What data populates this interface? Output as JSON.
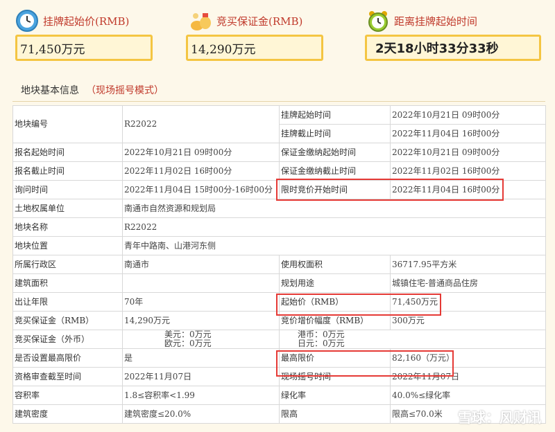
{
  "summary": {
    "start_price_label": "挂牌起始价(RMB)",
    "start_price_value": "71,450万元",
    "deposit_label": "竞买保证金(RMB)",
    "deposit_value": "14,290万元",
    "countdown_label": "距离挂牌起始时间",
    "countdown_value": "2天18小时33分33秒",
    "icons": [
      "clock-icon",
      "money-bag-icon",
      "alarm-clock-icon"
    ]
  },
  "section": {
    "title": "地块基本信息",
    "mode": "（现场摇号模式）"
  },
  "table": {
    "rows": [
      {
        "k1": "地块编号",
        "v1": "R22022",
        "k2a": "挂牌起始时间",
        "v2a": "2022年10月21日 09时00分",
        "k2b": "挂牌截止时间",
        "v2b": "2022年11月04日 16时00分"
      },
      {
        "k1": "报名起始时间",
        "v1": "2022年10月21日 09时00分",
        "k2": "保证金缴纳起始时间",
        "v2": "2022年10月21日 09时00分"
      },
      {
        "k1": "报名截止时间",
        "v1": "2022年11月02日 16时00分",
        "k2": "保证金缴纳截止时间",
        "v2": "2022年11月02日 16时00分"
      },
      {
        "k1": "询问时间",
        "v1": "2022年11月04日 15时00分-16时00分",
        "k2": "限时竞价开始时间",
        "v2": "2022年11月04日 16时00分"
      },
      {
        "k1": "土地权属单位",
        "v1": "南通市自然资源和规划局"
      },
      {
        "k1": "地块名称",
        "v1": "R22022"
      },
      {
        "k1": "地块位置",
        "v1": "青年中路南、山港河东侧"
      },
      {
        "k1": "所属行政区",
        "v1": "南通市",
        "k2": "使用权面积",
        "v2": "36717.95平方米"
      },
      {
        "k1": "建筑面积",
        "v1": "",
        "k2": "规划用途",
        "v2": "城镇住宅-普通商品住房"
      },
      {
        "k1": "出让年限",
        "v1": "70年",
        "k2": "起始价（RMB）",
        "v2": "71,450万元"
      },
      {
        "k1": "竞买保证金（RMB）",
        "v1": "14,290万元",
        "k2": "竞价增价幅度（RMB）",
        "v2": "300万元"
      },
      {
        "k1": "竞买保证金（外币）",
        "v1a": "美元：0万元",
        "v1b": "欧元：0万元",
        "v2a": "港币：0万元",
        "v2b": "日元：0万元"
      },
      {
        "k1": "是否设置最高限价",
        "v1": "是",
        "k2": "最高限价",
        "v2": "82,160（万元）"
      },
      {
        "k1": "资格审查截至时间",
        "v1": "2022年11月07日",
        "k2": "现场摇号时间",
        "v2": "2022年11月07日"
      },
      {
        "k1": "容积率",
        "v1": "1.8≤容积率<1.99",
        "k2": "绿化率",
        "v2": "40.0%≤绿化率"
      },
      {
        "k1": "建筑密度",
        "v1": "建筑密度≤20.0%",
        "k2": "限高",
        "v2": "限高≤70.0米"
      }
    ]
  },
  "watermark": "雪球：风财讯",
  "colors": {
    "accent_red": "#c0392b",
    "box_border": "#f4c542",
    "highlight_red": "#e53935"
  }
}
